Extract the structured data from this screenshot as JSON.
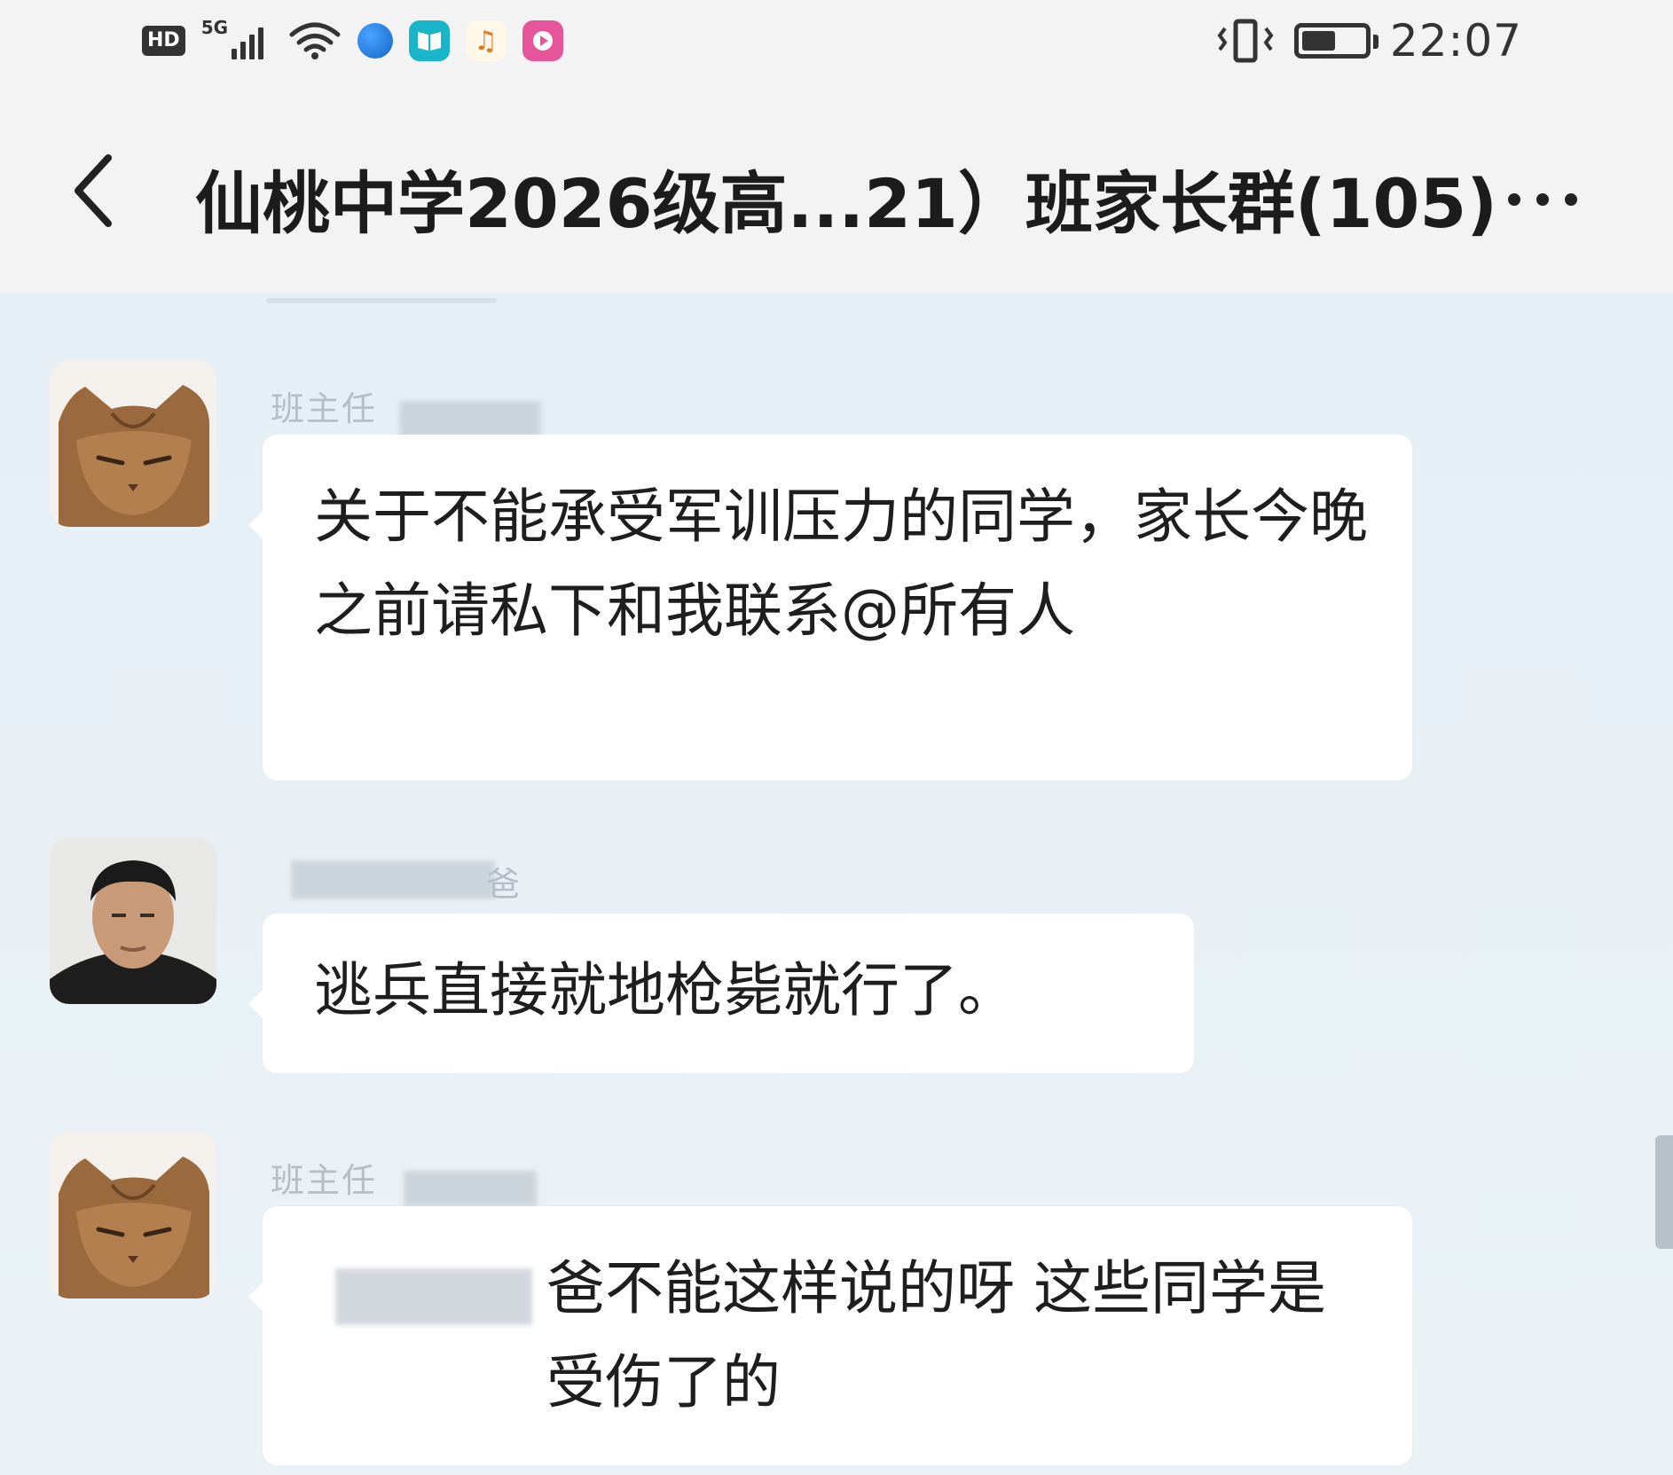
{
  "status_bar": {
    "hd_label": "HD",
    "network_label": "5G",
    "time": "22:07",
    "icons": [
      "hd-icon",
      "signal-icon",
      "wifi-icon",
      "browser-icon",
      "book-app-icon",
      "music-app-icon",
      "video-app-icon",
      "vibrate-icon",
      "battery-icon"
    ],
    "battery_level": 0.55
  },
  "header": {
    "title": "仙桃中学2026级高...21）班家长群(105)",
    "back_icon": "chevron-left-icon",
    "more_icon": "more-dots-icon"
  },
  "messages": [
    {
      "sender": "班主任",
      "avatar": "cat-avatar",
      "text": "关于不能承受军训压力的同学，家长今晚之前请私下和我联系@所有人"
    },
    {
      "sender": "爸",
      "avatar": "man-avatar",
      "text": "逃兵直接就地枪毙就行了。"
    },
    {
      "sender": "班主任",
      "avatar": "cat-avatar",
      "text": "爸不能这样说的呀 这些同学是受伤了的"
    }
  ],
  "colors": {
    "chat_background": "#e9f1f6",
    "bubble": "#ffffff",
    "header_background": "#f3f3f3",
    "text": "#1e1e1e",
    "sender_name": "#b5bec6"
  }
}
